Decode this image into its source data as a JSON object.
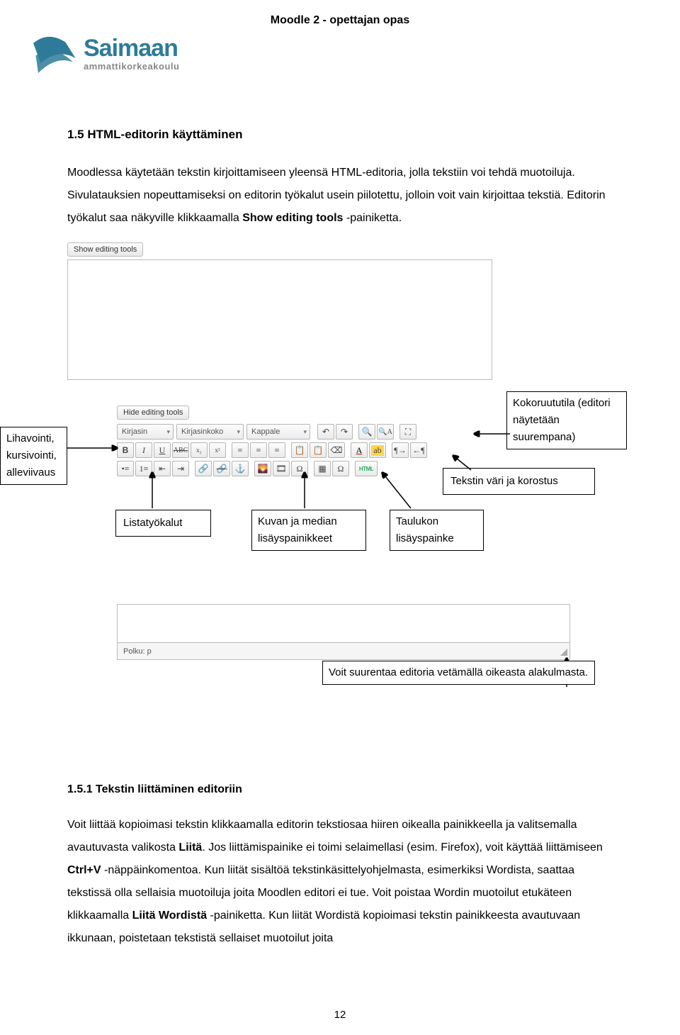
{
  "headerTitle": "Moodle 2 - opettajan opas",
  "logo": {
    "brand": "Saimaan",
    "sub": "ammattikorkeakoulu"
  },
  "section": {
    "num": "1.5 HTML-editorin käyttäminen",
    "introPart1": "Moodlessa käytetään tekstin kirjoittamiseen yleensä HTML-editoria, jolla tekstiin voi tehdä muotoiluja. Sivulatauksien nopeuttamiseksi on editorin työkalut usein piilotettu, jolloin voit vain kirjoittaa tekstiä. Editorin työkalut saa näkyville klikkaamalla ",
    "introBold1": "Show editing tools",
    "introPart2": " -painiketta."
  },
  "editor": {
    "showBtn": "Show editing tools",
    "hideBtn": "Hide editing tools",
    "font": "Kirjasin",
    "fontsize": "Kirjasinkoko",
    "para": "Kappale",
    "htmlLabel": "HTML",
    "path": "Polku: p"
  },
  "callouts": {
    "left": "Lihavointi, kursivointi, alleviivaus",
    "fullscreen": "Kokoruututila (editori näytetään suurempana)",
    "textcolor": "Tekstin väri ja korostus",
    "list": "Listatyökalut",
    "media": "Kuvan ja median lisäyspainikkeet",
    "table": "Taulukon lisäyspainke",
    "resize": "Voit suurentaa editoria vetämällä oikeasta alakulmasta."
  },
  "subsection": {
    "title": "1.5.1 Tekstin liittäminen editoriin",
    "p1a": "Voit liittää kopioimasi tekstin klikkaamalla editorin tekstiosaa hiiren oikealla painikkeella ja valitsemalla avautuvasta valikosta ",
    "p1b": "Liitä",
    "p1c": ". Jos liittämispainike ei toimi selaimellasi (esim. Firefox), voit käyttää liittämiseen ",
    "p1d": "Ctrl+V",
    "p1e": " -näppäinkomentoa. Kun liität sisältöä tekstinkäsittelyohjelmasta, esimerkiksi Wordista, saattaa tekstissä olla sellaisia muotoiluja joita Moodlen editori ei tue. Voit poistaa Wordin muotoilut etukäteen klikkaamalla ",
    "p1f": "Liitä Wordistä",
    "p1g": " -painiketta. Kun liität Wordistä kopioimasi tekstin painikkeesta avautuvaan ikkunaan, poistetaan tekstistä sellaiset muotoilut joita"
  },
  "pageNumber": "12"
}
